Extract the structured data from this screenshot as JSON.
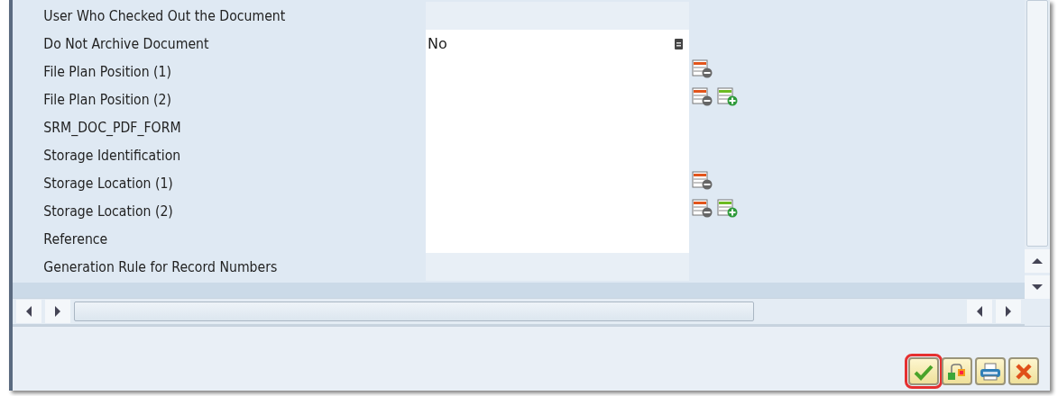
{
  "rows": [
    {
      "label": "User Who Checked Out the Document",
      "kind": "plain",
      "actions": []
    },
    {
      "label": "Do Not Archive Document",
      "kind": "field",
      "value": "No",
      "value_help": true,
      "actions": []
    },
    {
      "label": "File Plan Position (1)",
      "kind": "field",
      "actions": [
        {
          "kind": "remove"
        }
      ]
    },
    {
      "label": "File Plan Position (2)",
      "kind": "field",
      "actions": [
        {
          "kind": "remove"
        },
        {
          "kind": "add"
        }
      ]
    },
    {
      "label": "SRM_DOC_PDF_FORM",
      "kind": "field",
      "actions": []
    },
    {
      "label": "Storage Identification",
      "kind": "field",
      "actions": []
    },
    {
      "label": "Storage Location (1)",
      "kind": "field",
      "actions": [
        {
          "kind": "remove"
        }
      ]
    },
    {
      "label": "Storage Location (2)",
      "kind": "field",
      "actions": [
        {
          "kind": "remove"
        },
        {
          "kind": "add"
        }
      ]
    },
    {
      "label": "Reference",
      "kind": "field",
      "actions": []
    },
    {
      "label": "Generation Rule for Record Numbers",
      "kind": "plain",
      "actions": []
    }
  ],
  "buttons": [
    {
      "kind": "confirm",
      "highlighted": true
    },
    {
      "kind": "hierarchy",
      "highlighted": false
    },
    {
      "kind": "print",
      "highlighted": false
    },
    {
      "kind": "cancel",
      "highlighted": false
    }
  ]
}
